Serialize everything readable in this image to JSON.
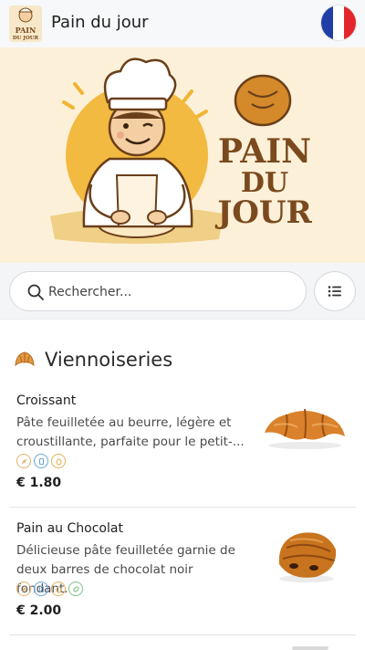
{
  "header": {
    "logo_text": [
      "PAIN",
      "DU JOUR"
    ],
    "title": "Pain du jour",
    "language_flag": "france-flag-icon"
  },
  "hero": {
    "brand_lines": [
      "PAIN",
      "DU",
      "JOUR"
    ]
  },
  "search": {
    "placeholder": "Rechercher...",
    "value": "",
    "icon": "search-icon",
    "filter_icon": "list-icon"
  },
  "category": {
    "title": "Viennoiseries",
    "icon": "croissant-icon"
  },
  "products": [
    {
      "name": "Croissant",
      "description": "Pâte feuilletée au beurre, légère et croustillante, parfaite pour le petit-...",
      "allergens": [
        "gluten-icon",
        "milk-icon",
        "egg-icon"
      ],
      "price": "€ 1.80",
      "image": "croissant-photo"
    },
    {
      "name": "Pain au Chocolat",
      "description": "Délicieuse pâte feuilletée garnie de deux barres de chocolat noir fondant.",
      "allergens": [
        "gluten-icon",
        "milk-icon",
        "egg-icon",
        "soy-icon"
      ],
      "price": "€ 2.00",
      "image": "pain-au-chocolat-photo"
    }
  ],
  "colors": {
    "header_bg": "#f7f8f9",
    "hero_bg": "#fcf0d8",
    "brand_brown": "#7a4a1e",
    "sun_yellow": "#f2b431",
    "gluten": "#e0b46a",
    "milk": "#6aa6d6",
    "egg": "#e3b15c",
    "soy": "#7cc08a"
  }
}
